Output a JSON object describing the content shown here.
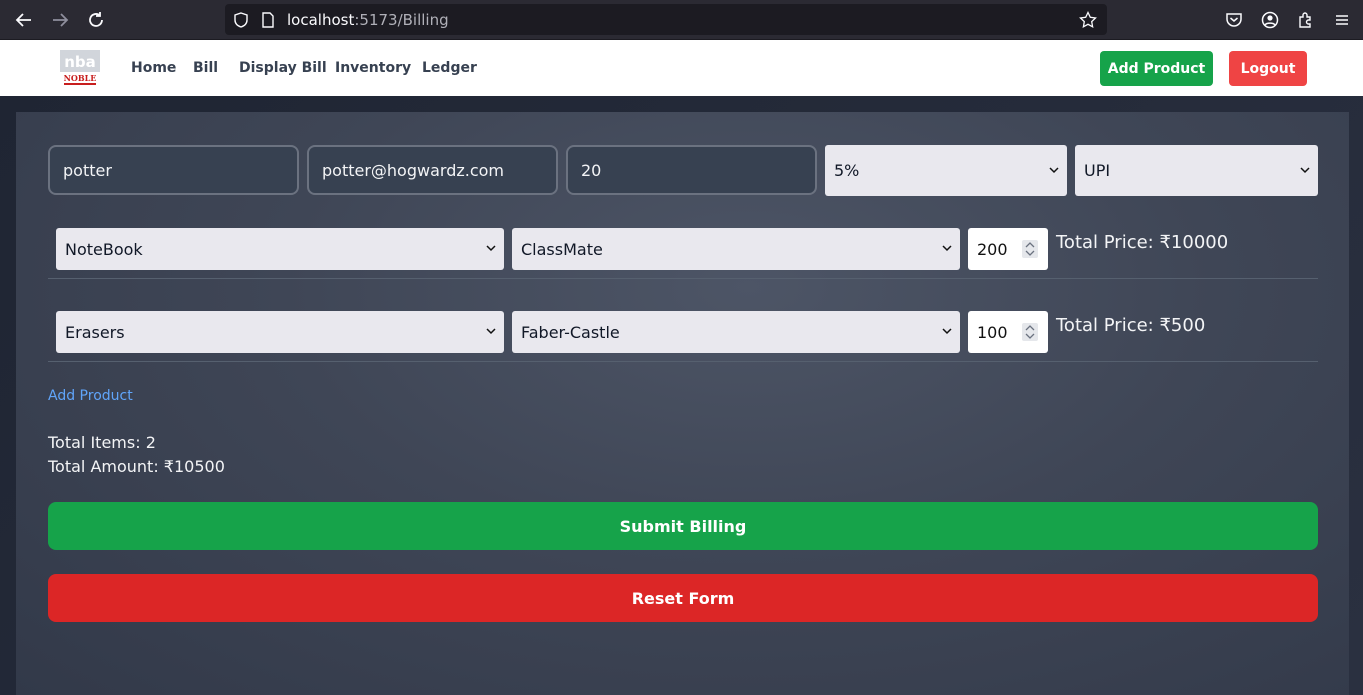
{
  "browser": {
    "url_host": "localhost",
    "url_path": ":5173/Billing"
  },
  "navbar": {
    "logo_text": "nba",
    "logo_subtext": "NOBLE",
    "links": [
      "Home",
      "Bill",
      "Display Bill",
      "Inventory",
      "Ledger"
    ],
    "add_product_label": "Add Product",
    "logout_label": "Logout",
    "colors": {
      "add_product": "#16a34a",
      "logout": "#ef4444"
    }
  },
  "customer": {
    "name": "potter",
    "email": "potter@hogwardz.com",
    "number": "20",
    "discount": "5%",
    "payment_method": "UPI"
  },
  "products": [
    {
      "category": "NoteBook",
      "brand": "ClassMate",
      "quantity": "200",
      "total_label": "Total Price: ₹10000"
    },
    {
      "category": "Erasers",
      "brand": "Faber-Castle",
      "quantity": "100",
      "total_label": "Total Price: ₹500"
    }
  ],
  "add_product_link": "Add Product",
  "summary": {
    "total_items": "Total Items: 2",
    "total_amount": "Total Amount: ₹10500"
  },
  "actions": {
    "submit_label": "Submit Billing",
    "reset_label": "Reset Form",
    "colors": {
      "submit": "#16a34a",
      "reset": "#dc2626"
    }
  }
}
